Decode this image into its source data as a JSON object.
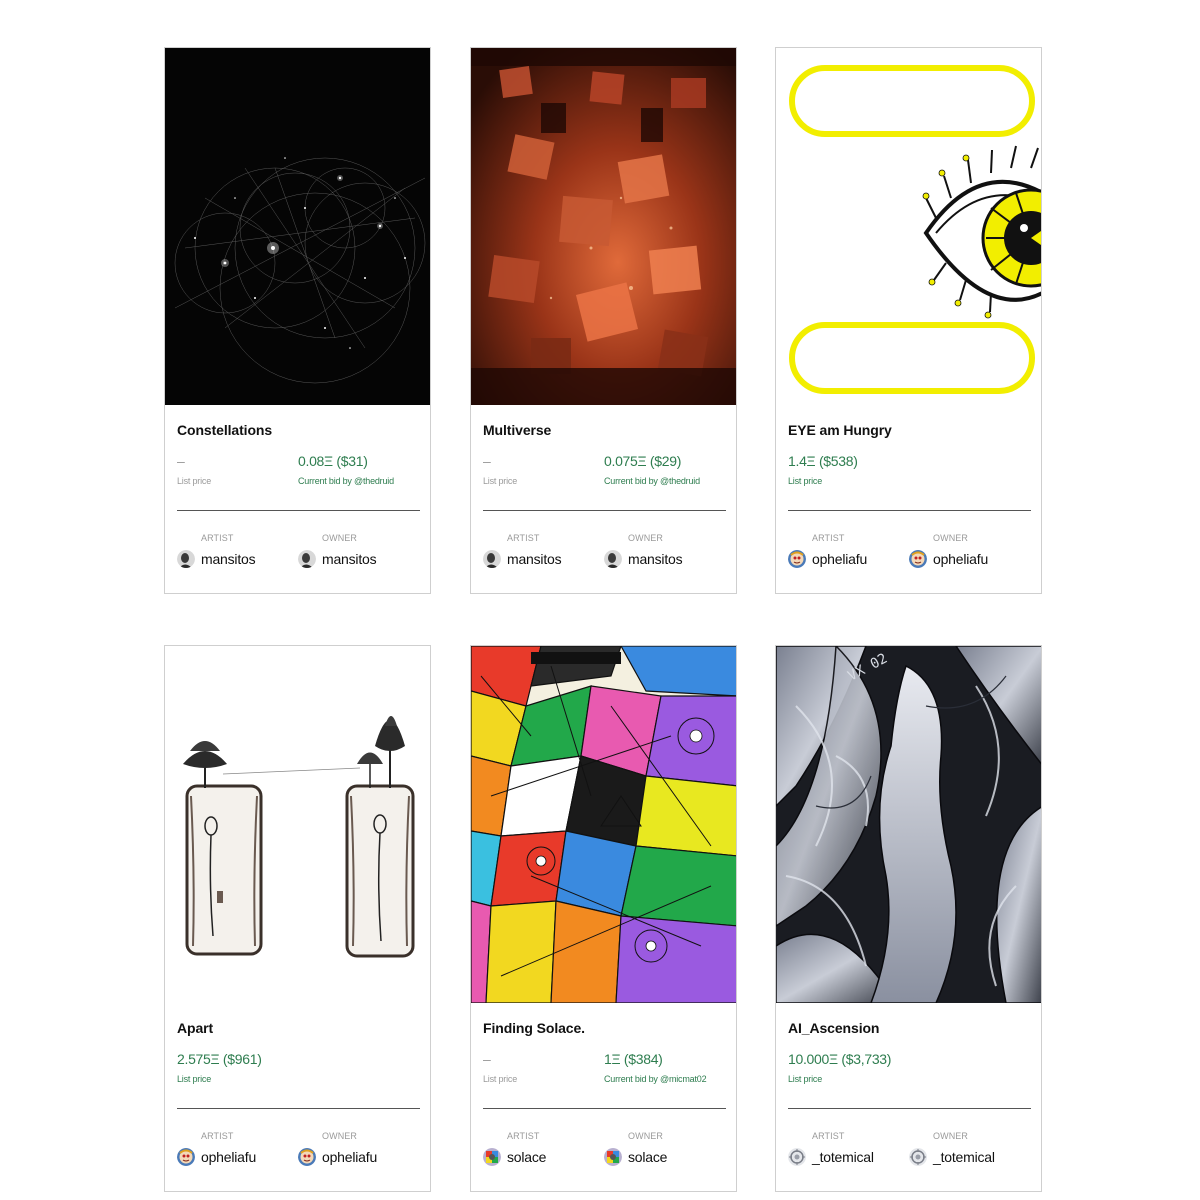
{
  "labels": {
    "artist": "ARTIST",
    "owner": "OWNER"
  },
  "cards": [
    {
      "title": "Constellations",
      "left_value": "–",
      "left_label": "List price",
      "right_value": "0.08Ξ ($31)",
      "right_label": "Current bid by @thedruid",
      "artist": "mansitos",
      "owner": "mansitos"
    },
    {
      "title": "Multiverse",
      "left_value": "–",
      "left_label": "List price",
      "right_value": "0.075Ξ ($29)",
      "right_label": "Current bid by @thedruid",
      "artist": "mansitos",
      "owner": "mansitos"
    },
    {
      "title": "EYE am Hungry",
      "left_value": "1.4Ξ ($538)",
      "left_label": "List price",
      "artist": "opheliafu",
      "owner": "opheliafu"
    },
    {
      "title": "Apart",
      "left_value": "2.575Ξ ($961)",
      "left_label": "List price",
      "artist": "opheliafu",
      "owner": "opheliafu"
    },
    {
      "title": "Finding Solace.",
      "left_value": "–",
      "left_label": "List price",
      "right_value": "1Ξ ($384)",
      "right_label": "Current bid by @micmat02",
      "artist": "solace",
      "owner": "solace"
    },
    {
      "title": "AI_Ascension",
      "left_value": "10.000Ξ ($3,733)",
      "left_label": "List price",
      "artist": "_totemical",
      "owner": "_totemical"
    }
  ],
  "colors": {
    "price_green": "#2e7d4f",
    "muted_gray": "#9a9a9a",
    "border": "#cfcfcf",
    "eye_yellow": "#f2ee00"
  }
}
